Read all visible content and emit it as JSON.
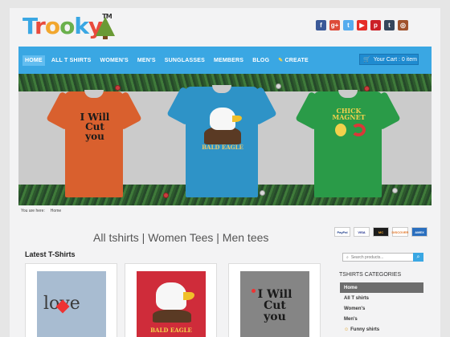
{
  "brand": {
    "name": "Trooky",
    "tm": "TM"
  },
  "social": [
    {
      "icon": "facebook-icon",
      "glyph": "f",
      "color": "#3b5998"
    },
    {
      "icon": "google-plus-icon",
      "glyph": "g+",
      "color": "#dd4b39"
    },
    {
      "icon": "twitter-icon",
      "glyph": "t",
      "color": "#55acee"
    },
    {
      "icon": "youtube-icon",
      "glyph": "▶",
      "color": "#e52d27"
    },
    {
      "icon": "pinterest-icon",
      "glyph": "p",
      "color": "#cb2027"
    },
    {
      "icon": "tumblr-icon",
      "glyph": "t",
      "color": "#35465c"
    },
    {
      "icon": "instagram-icon",
      "glyph": "◎",
      "color": "#a0522d"
    }
  ],
  "nav": {
    "items": [
      "HOME",
      "ALL T SHIRTS",
      "WOMEN'S",
      "MEN'S",
      "SUNGLASSES",
      "MEMBERS",
      "BLOG",
      "CREATE"
    ],
    "cart": "Your Cart : 0 item"
  },
  "banner": {
    "shirts": [
      {
        "color": "#d9602e",
        "lines": [
          "I Will",
          "Cut",
          "you"
        ]
      },
      {
        "color": "#2e93c7",
        "caption": "BALD EAGLE"
      },
      {
        "color": "#2a9b48",
        "lines": [
          "CHICK",
          "MAGNET"
        ]
      }
    ]
  },
  "breadcrumb": {
    "label": "You are here:",
    "current": "Home"
  },
  "main": {
    "heading": "All tshirts | Women Tees | Men tees",
    "section_title": "Latest T-Shirts",
    "products": [
      {
        "bg": "#a8bcd1",
        "text": "love"
      },
      {
        "bg": "#cf2c3a",
        "text": "BALD EAGLE"
      },
      {
        "bg": "#858585",
        "lines": [
          "I Will",
          "Cut",
          "you"
        ]
      }
    ]
  },
  "payments": [
    "PayPal",
    "VISA",
    "MC",
    "DISCOVER",
    "AMEX"
  ],
  "sidebar": {
    "search_placeholder": "Search products...",
    "categories_title": "TSHIRTS CATEGORIES",
    "categories": [
      "Home",
      "All T shirts",
      "Women's",
      "Men's",
      "Funny shirts"
    ]
  },
  "colors": {
    "nav": "#3aa7e3",
    "accent": "#1f8bd0"
  }
}
